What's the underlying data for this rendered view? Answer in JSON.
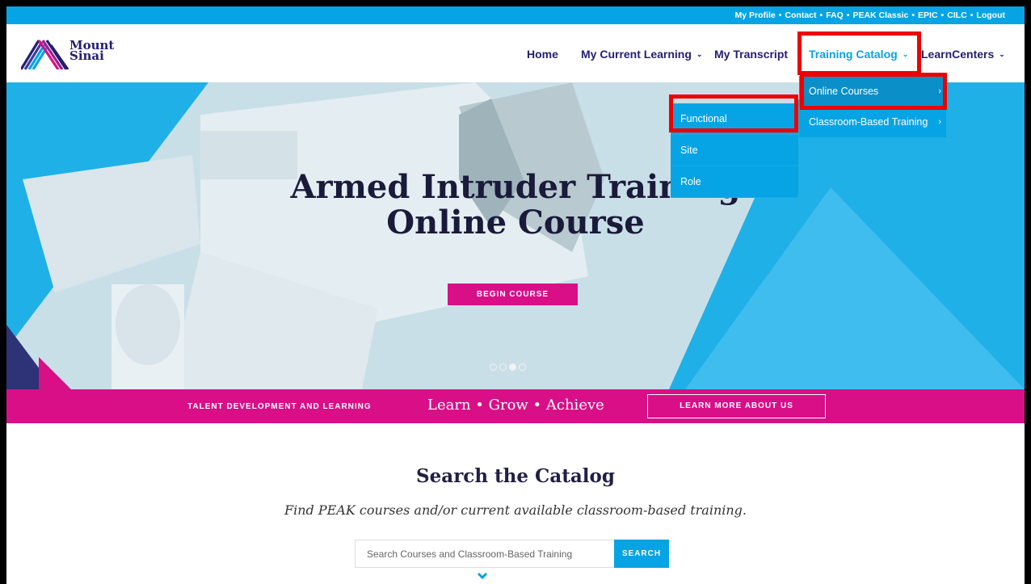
{
  "util_links": [
    "My Profile",
    "Contact",
    "FAQ",
    "PEAK Classic",
    "EPIC",
    "CILC",
    "Logout"
  ],
  "logo": {
    "line1": "Mount",
    "line2": "Sinai"
  },
  "nav": {
    "home": "Home",
    "current_learning": "My Current Learning",
    "transcript": "My Transcript",
    "catalog": "Training Catalog",
    "learncenters": "LearnCenters"
  },
  "catalog_menu": {
    "online": "Online Courses",
    "classroom": "Classroom-Based Training"
  },
  "online_submenu": {
    "functional": "Functional",
    "site": "Site",
    "role": "Role"
  },
  "hero": {
    "title_line1": "Armed Intruder Training",
    "title_line2": "Online Course",
    "button": "BEGIN COURSE",
    "slide_count": 4,
    "active_slide": 3
  },
  "band": {
    "left": "TALENT DEVELOPMENT AND LEARNING",
    "middle": "Learn • Grow • Achieve",
    "button": "LEARN MORE ABOUT US"
  },
  "search": {
    "title": "Search the Catalog",
    "subtitle": "Find PEAK courses and/or current available classroom-based training.",
    "placeholder": "Search Courses and Classroom-Based Training",
    "button": "SEARCH"
  },
  "colors": {
    "primary_blue": "#06a4e4",
    "magenta": "#d80f87",
    "navy": "#221f72",
    "highlight": "#ee0000"
  }
}
